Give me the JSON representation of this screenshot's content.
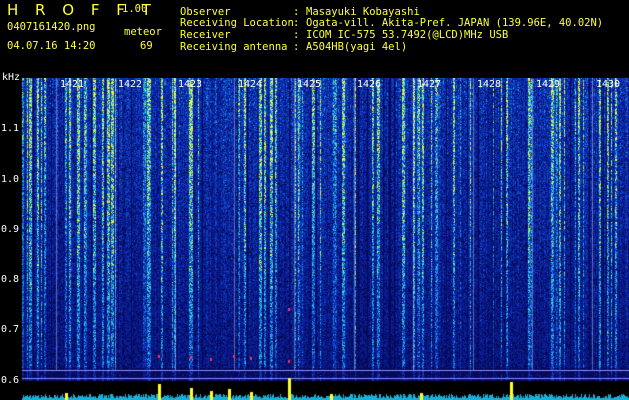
{
  "app": {
    "title": "H R O F F T",
    "version": "1.00"
  },
  "file": {
    "name": "0407161420.png",
    "datetime": "04.07.16 14:20"
  },
  "counter": {
    "label": "meteor",
    "value": "69"
  },
  "info": [
    {
      "key": "Observer",
      "value": "Masayuki Kobayashi"
    },
    {
      "key": "Receiving Location",
      "value": "Ogata-vill. Akita-Pref. JAPAN (139.96E, 40.02N)"
    },
    {
      "key": "Receiver",
      "value": "ICOM IC-575 53.7492(@LCD)MHz USB"
    },
    {
      "key": "Receiving antenna",
      "value": "A504HB(yagi 4el)"
    }
  ],
  "axis": {
    "unit": "kHz",
    "y_ticks": [
      "1.1",
      "1.0",
      "0.9",
      "0.8",
      "0.7",
      "0.6"
    ],
    "time_labels": [
      "1421",
      "1422",
      "1423",
      "1424",
      "1425",
      "1426",
      "1427",
      "1428",
      "1429",
      "1430"
    ]
  },
  "colors": {
    "text": "#ffff3c",
    "background": "#000000",
    "spectrum_base": "#0a1a8a"
  }
}
